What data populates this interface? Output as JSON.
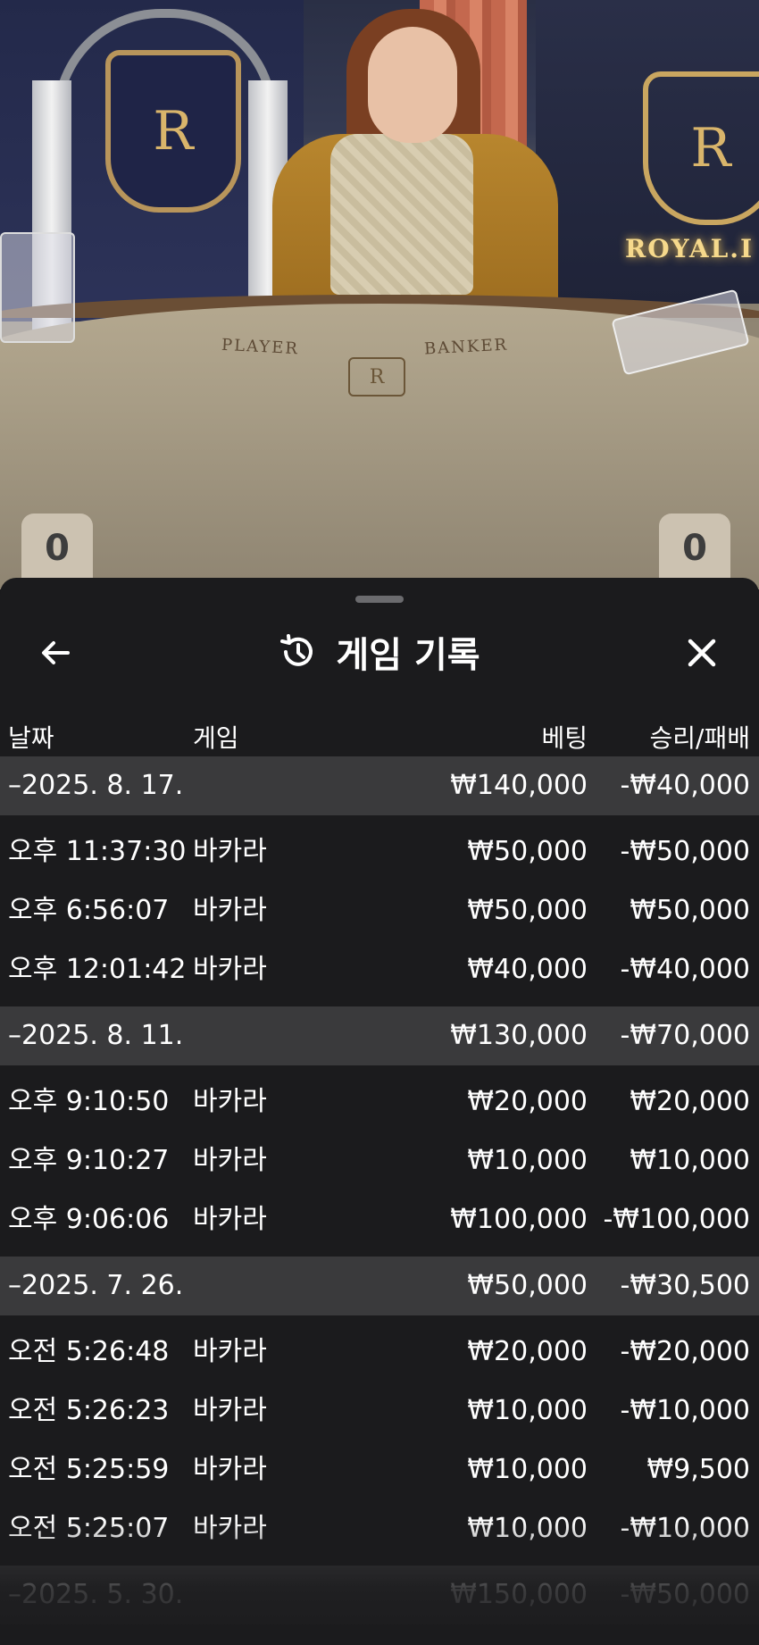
{
  "video": {
    "felt_labels": {
      "player": "PLAYER",
      "banker": "BANKER"
    },
    "brand_text": "ROYAL.I",
    "crest_letter": "R",
    "player_score": "0",
    "banker_score": "0"
  },
  "sheet": {
    "title": "게임 기록",
    "title_icon": "history-icon",
    "back_icon": "arrow-left-icon",
    "close_icon": "close-icon",
    "columns": {
      "date": "날짜",
      "game": "게임",
      "bet": "베팅",
      "win_loss": "승리/패배"
    },
    "groups": [
      {
        "date": "–2025. 8. 17.",
        "bet": "₩140,000",
        "win_loss": "-₩40,000",
        "rows": [
          {
            "time": "오후 11:37:30",
            "game": "바카라",
            "bet": "₩50,000",
            "win_loss": "-₩50,000"
          },
          {
            "time": "오후 6:56:07",
            "game": "바카라",
            "bet": "₩50,000",
            "win_loss": "₩50,000"
          },
          {
            "time": "오후 12:01:42",
            "game": "바카라",
            "bet": "₩40,000",
            "win_loss": "-₩40,000"
          }
        ]
      },
      {
        "date": "–2025. 8. 11.",
        "bet": "₩130,000",
        "win_loss": "-₩70,000",
        "rows": [
          {
            "time": "오후 9:10:50",
            "game": "바카라",
            "bet": "₩20,000",
            "win_loss": "₩20,000"
          },
          {
            "time": "오후 9:10:27",
            "game": "바카라",
            "bet": "₩10,000",
            "win_loss": "₩10,000"
          },
          {
            "time": "오후 9:06:06",
            "game": "바카라",
            "bet": "₩100,000",
            "win_loss": "-₩100,000"
          }
        ]
      },
      {
        "date": "–2025. 7. 26.",
        "bet": "₩50,000",
        "win_loss": "-₩30,500",
        "rows": [
          {
            "time": "오전 5:26:48",
            "game": "바카라",
            "bet": "₩20,000",
            "win_loss": "-₩20,000"
          },
          {
            "time": "오전 5:26:23",
            "game": "바카라",
            "bet": "₩10,000",
            "win_loss": "-₩10,000"
          },
          {
            "time": "오전 5:25:59",
            "game": "바카라",
            "bet": "₩10,000",
            "win_loss": "₩9,500"
          },
          {
            "time": "오전 5:25:07",
            "game": "바카라",
            "bet": "₩10,000",
            "win_loss": "-₩10,000"
          }
        ]
      },
      {
        "date": "–2025. 5. 30.",
        "bet": "₩150,000",
        "win_loss": "-₩50,000",
        "rows": []
      }
    ]
  }
}
